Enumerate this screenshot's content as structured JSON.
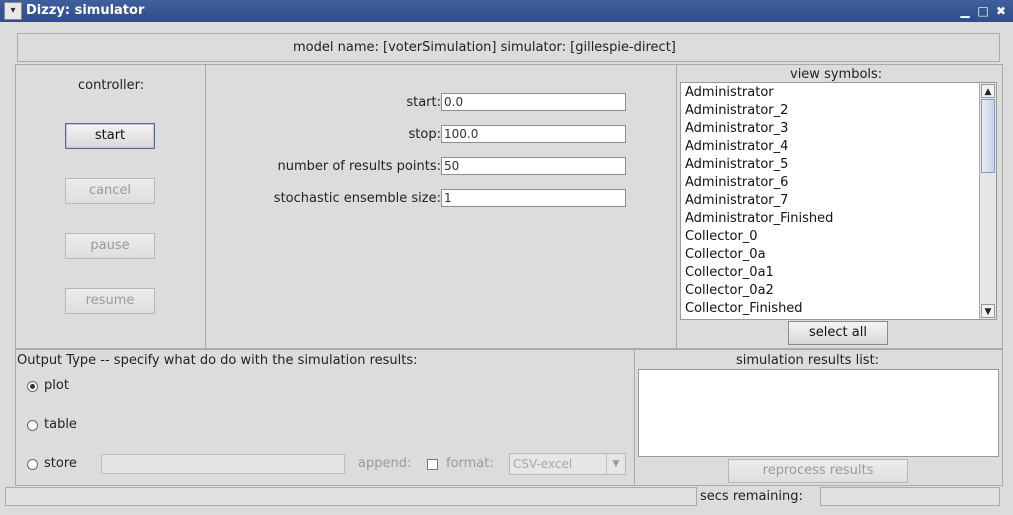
{
  "window": {
    "title": "Dizzy: simulator",
    "menu_glyph": "▾",
    "min_glyph": "▁",
    "max_glyph": "□",
    "close_glyph": "✖"
  },
  "header": {
    "text": "model name: [voterSimulation]  simulator: [gillespie-direct]"
  },
  "controller": {
    "label": "controller:",
    "start": "start",
    "cancel": "cancel",
    "pause": "pause",
    "resume": "resume"
  },
  "params": {
    "start_label": "start:",
    "start_value": "0.0",
    "stop_label": "stop:",
    "stop_value": "100.0",
    "points_label": "number of results points:",
    "points_value": "50",
    "ensemble_label": "stochastic ensemble size:",
    "ensemble_value": "1"
  },
  "symbols": {
    "header": "view symbols:",
    "items": [
      "Administrator",
      "Administrator_2",
      "Administrator_3",
      "Administrator_4",
      "Administrator_5",
      "Administrator_6",
      "Administrator_7",
      "Administrator_Finished",
      "Collector_0",
      "Collector_0a",
      "Collector_0a1",
      "Collector_0a2",
      "Collector_Finished"
    ],
    "select_all": "select all"
  },
  "output": {
    "header": "Output Type -- specify what do do with the simulation results:",
    "plot": "plot",
    "table": "table",
    "store": "store",
    "append_label": "append:",
    "format_label": "format:",
    "format_value": "CSV-excel",
    "selected": "plot"
  },
  "results": {
    "header": "simulation results list:",
    "reprocess": "reprocess results"
  },
  "status": {
    "secs_label": "secs remaining:",
    "secs_value": "",
    "progress": 0
  }
}
